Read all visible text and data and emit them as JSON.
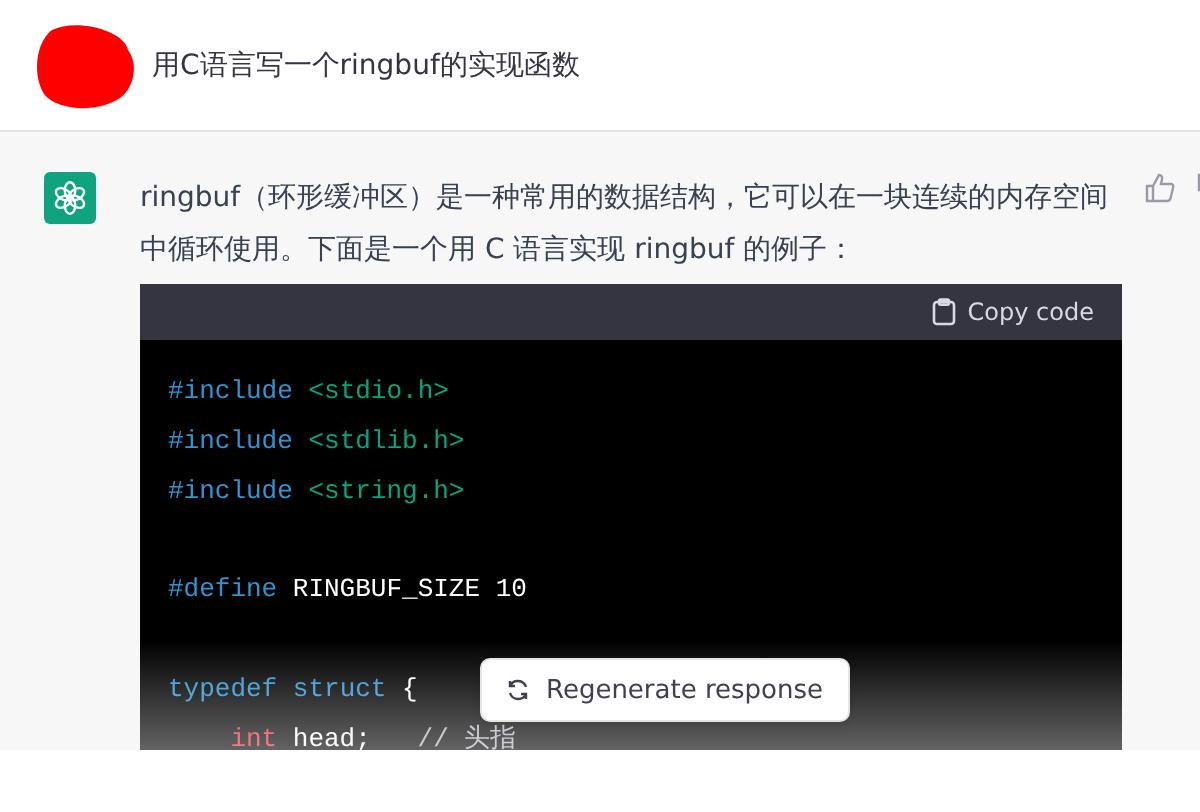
{
  "user_message": {
    "text": "用C语言写一个ringbuf的实现函数"
  },
  "assistant_message": {
    "text": "ringbuf（环形缓冲区）是一种常用的数据结构，它可以在一块连续的内存空间中循环使用。下面是一个用 C 语言实现 ringbuf 的例子：",
    "code_block": {
      "copy_label": "Copy code",
      "lines": [
        {
          "kind": "code",
          "indent": false,
          "tokens": [
            {
              "kind": "keyword",
              "text": "#include"
            },
            {
              "kind": "string",
              "text": "<stdio.h>"
            }
          ]
        },
        {
          "kind": "code",
          "indent": false,
          "tokens": [
            {
              "kind": "keyword",
              "text": "#include"
            },
            {
              "kind": "string",
              "text": "<stdlib.h>"
            }
          ]
        },
        {
          "kind": "code",
          "indent": false,
          "tokens": [
            {
              "kind": "keyword",
              "text": "#include"
            },
            {
              "kind": "string",
              "text": "<string.h>"
            }
          ]
        },
        {
          "kind": "blank"
        },
        {
          "kind": "code",
          "indent": false,
          "tokens": [
            {
              "kind": "keyword",
              "text": "#define"
            },
            {
              "kind": "plain",
              "text": "RINGBUF_SIZE 10"
            }
          ]
        },
        {
          "kind": "blank"
        },
        {
          "kind": "code",
          "indent": false,
          "tokens": [
            {
              "kind": "keyword",
              "text": "typedef struct"
            },
            {
              "kind": "plain",
              "text": "{"
            }
          ]
        },
        {
          "kind": "code",
          "indent": true,
          "tokens": [
            {
              "kind": "type",
              "text": "int"
            },
            {
              "kind": "plain",
              "text": "head;"
            },
            {
              "kind": "comment",
              "text": "// 头指"
            }
          ]
        }
      ]
    }
  },
  "regenerate_button": {
    "label": "Regenerate response"
  }
}
